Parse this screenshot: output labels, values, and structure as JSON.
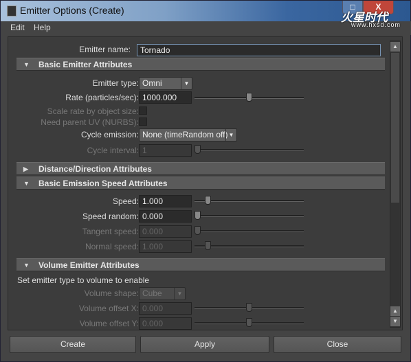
{
  "window": {
    "title": "Emitter Options (Create)",
    "watermark": "火星时代",
    "watermark_url": "www.hxsd.com"
  },
  "menu": [
    "Edit",
    "Help"
  ],
  "emitter_name": {
    "label": "Emitter name:",
    "value": "Tornado"
  },
  "sections": {
    "basic": {
      "title": "Basic Emitter Attributes",
      "expanded": true,
      "emitter_type": {
        "label": "Emitter type:",
        "value": "Omni"
      },
      "rate": {
        "label": "Rate (particles/sec):",
        "value": "1000.000",
        "slider": 0.5
      },
      "scale_rate": {
        "label": "Scale rate by object size:",
        "checked": false
      },
      "need_parent_uv": {
        "label": "Need parent UV (NURBS):",
        "checked": false
      },
      "cycle_emission": {
        "label": "Cycle emission:",
        "value": "None (timeRandom off)"
      },
      "cycle_interval": {
        "label": "Cycle interval:",
        "value": "1",
        "slider": 0
      }
    },
    "distance": {
      "title": "Distance/Direction Attributes",
      "expanded": false
    },
    "speed": {
      "title": "Basic Emission Speed Attributes",
      "expanded": true,
      "speed": {
        "label": "Speed:",
        "value": "1.000",
        "slider": 0.1
      },
      "speed_random": {
        "label": "Speed random:",
        "value": "0.000",
        "slider": 0
      },
      "tangent_speed": {
        "label": "Tangent speed:",
        "value": "0.000",
        "slider": 0
      },
      "normal_speed": {
        "label": "Normal speed:",
        "value": "1.000",
        "slider": 0.1
      }
    },
    "volume": {
      "title": "Volume Emitter Attributes",
      "expanded": true,
      "note": "Set emitter type to volume to enable",
      "volume_shape": {
        "label": "Volume shape:",
        "value": "Cube"
      },
      "offset_x": {
        "label": "Volume offset X:",
        "value": "0.000",
        "slider": 0.5
      },
      "offset_y": {
        "label": "Volume offset Y:",
        "value": "0.000",
        "slider": 0.5
      }
    }
  },
  "buttons": {
    "create": "Create",
    "apply": "Apply",
    "close": "Close"
  }
}
